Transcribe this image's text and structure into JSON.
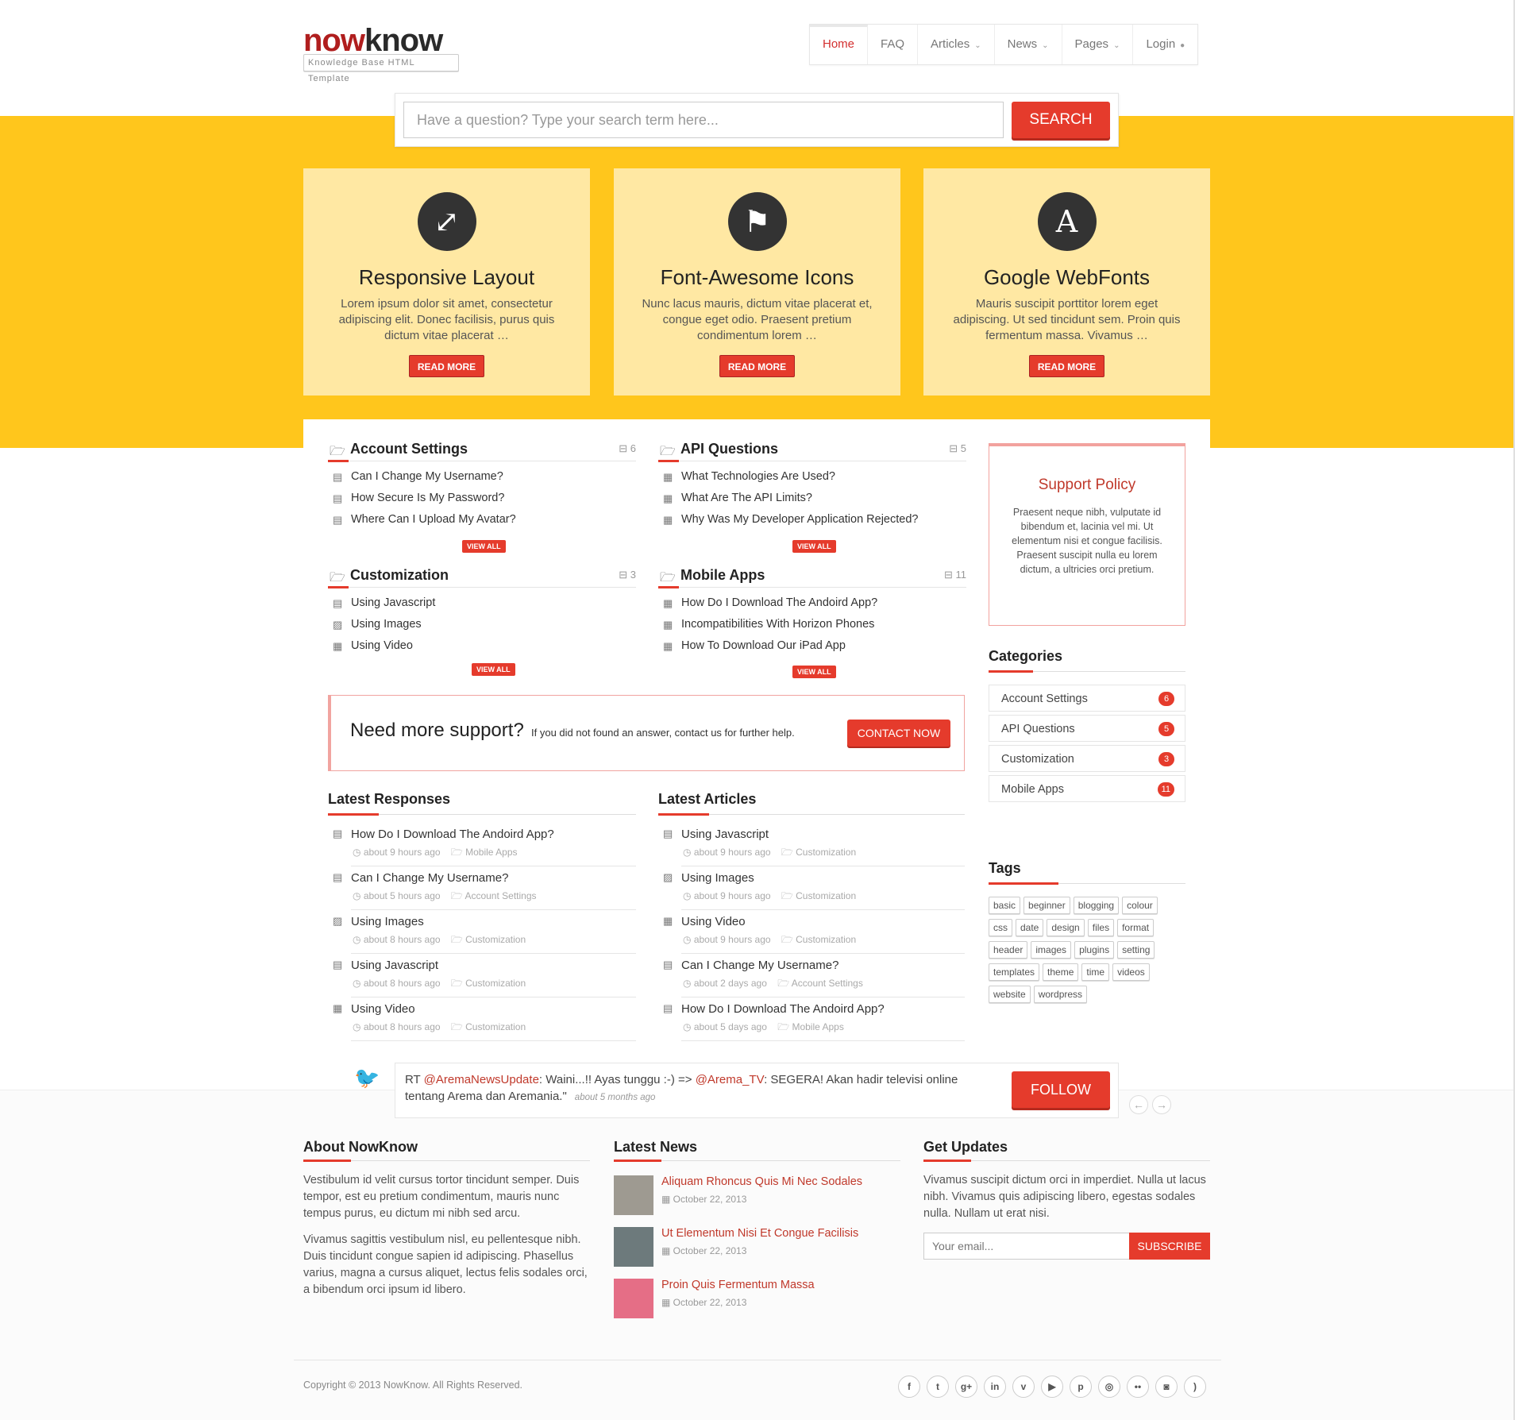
{
  "brand": {
    "logo_now": "now",
    "logo_know": "know",
    "logo_tagline": "Knowledge Base HTML Template"
  },
  "nav": [
    {
      "label": "Home",
      "active": true
    },
    {
      "label": "FAQ"
    },
    {
      "label": "Articles",
      "caret": "⌄"
    },
    {
      "label": "News",
      "caret": "⌄"
    },
    {
      "label": "Pages",
      "caret": "⌄"
    },
    {
      "label": "Login",
      "caret": "●"
    }
  ],
  "search": {
    "placeholder": "Have a question? Type your search term here...",
    "button": "SEARCH"
  },
  "features": [
    {
      "icon": "expand-arrows-icon",
      "glyph": "⤢",
      "title": "Responsive Layout",
      "text": "Lorem ipsum dolor sit amet, consectetur adipiscing elit. Donec facilisis, purus quis dictum vitae placerat …",
      "button": "READ MORE"
    },
    {
      "icon": "flag-icon",
      "glyph": "⚑",
      "title": "Font-Awesome Icons",
      "text": "Nunc lacus mauris, dictum vitae placerat et, congue eget odio. Praesent pretium condimentum lorem …",
      "button": "READ MORE"
    },
    {
      "icon": "font-a-icon",
      "glyph": "A",
      "title": "Google WebFonts",
      "text": "Mauris suscipit porttitor lorem eget adipiscing. Ut sed tincidunt sem. Proin quis fermentum massa. Vivamus …",
      "button": "READ MORE"
    }
  ],
  "categories_blocks": [
    {
      "title": "Account Settings",
      "count": "6",
      "items": [
        "Can I Change My Username?",
        "How Secure Is My Password?",
        "Where Can I Upload My Avatar?"
      ],
      "view_all": "VIEW ALL"
    },
    {
      "title": "API Questions",
      "count": "5",
      "items": [
        "What Technologies Are Used?",
        "What Are The API Limits?",
        "Why Was My Developer Application Rejected?"
      ],
      "view_all": "VIEW ALL"
    },
    {
      "title": "Customization",
      "count": "3",
      "items": [
        "Using Javascript",
        "Using Images",
        "Using Video"
      ],
      "view_all": "VIEW ALL"
    },
    {
      "title": "Mobile Apps",
      "count": "11",
      "items": [
        "How Do I Download The Andoird App?",
        "Incompatibilities With Horizon Phones",
        "How To Download Our iPad App"
      ],
      "view_all": "VIEW ALL"
    }
  ],
  "support": {
    "big": "Need more support?",
    "small": "If you did not found an answer, contact us for further help.",
    "button": "CONTACT NOW"
  },
  "latest_responses": {
    "title": "Latest Responses",
    "items": [
      {
        "title": "How Do I Download The Andoird App?",
        "time": "about 9 hours ago",
        "cat": "Mobile Apps"
      },
      {
        "title": "Can I Change My Username?",
        "time": "about 5 hours ago",
        "cat": "Account Settings"
      },
      {
        "title": "Using Images",
        "time": "about 8 hours ago",
        "cat": "Customization"
      },
      {
        "title": "Using Javascript",
        "time": "about 8 hours ago",
        "cat": "Customization"
      },
      {
        "title": "Using Video",
        "time": "about 8 hours ago",
        "cat": "Customization"
      }
    ]
  },
  "latest_articles": {
    "title": "Latest Articles",
    "items": [
      {
        "title": "Using Javascript",
        "time": "about 9 hours ago",
        "cat": "Customization"
      },
      {
        "title": "Using Images",
        "time": "about 9 hours ago",
        "cat": "Customization"
      },
      {
        "title": "Using Video",
        "time": "about 9 hours ago",
        "cat": "Customization"
      },
      {
        "title": "Can I Change My Username?",
        "time": "about 2 days ago",
        "cat": "Account Settings"
      },
      {
        "title": "How Do I Download The Andoird App?",
        "time": "about 5 days ago",
        "cat": "Mobile Apps"
      }
    ]
  },
  "sidebar": {
    "policy_title": "Support Policy",
    "policy_text": "Praesent neque nibh, vulputate id bibendum et, lacinia vel mi. Ut elementum nisi et congue facilisis. Praesent suscipit nulla eu lorem dictum, a ultricies orci pretium.",
    "categories_title": "Categories",
    "categories": [
      {
        "name": "Account Settings",
        "count": "6"
      },
      {
        "name": "API Questions",
        "count": "5"
      },
      {
        "name": "Customization",
        "count": "3"
      },
      {
        "name": "Mobile Apps",
        "count": "11"
      }
    ],
    "tags_title": "Tags",
    "tags": [
      "basic",
      "beginner",
      "blogging",
      "colour",
      "css",
      "date",
      "design",
      "files",
      "format",
      "header",
      "images",
      "plugins",
      "setting",
      "templates",
      "theme",
      "time",
      "videos",
      "website",
      "wordpress"
    ]
  },
  "tweet": {
    "rt": "RT ",
    "handle1": "@AremaNewsUpdate",
    "text1": ": Waini...!! Ayas tunggu :-) => ",
    "handle2": "@Arema_TV",
    "text2": ": SEGERA! Akan hadir televisi online tentang Arema dan Aremania.\"",
    "ago": "about 5 months ago",
    "button": "FOLLOW"
  },
  "footer": {
    "about_title": "About NowKnow",
    "about_p1": "Vestibulum id velit cursus tortor tincidunt semper. Duis tempor, est eu pretium condimentum, mauris nunc tempus purus, eu dictum mi nibh sed arcu.",
    "about_p2": "Vivamus sagittis vestibulum nisl, eu pellentesque nibh. Duis tincidunt congue sapien id adipiscing. Phasellus varius, magna a cursus aliquet, lectus felis sodales orci, a bibendum orci ipsum id libero.",
    "news_title": "Latest News",
    "news": [
      {
        "title": "Aliquam Rhoncus Quis Mi Nec Sodales",
        "date": "October 22, 2013"
      },
      {
        "title": "Ut Elementum Nisi Et Congue Facilisis",
        "date": "October 22, 2013"
      },
      {
        "title": "Proin Quis Fermentum Massa",
        "date": "October 22, 2013"
      }
    ],
    "updates_title": "Get Updates",
    "updates_text": "Vivamus suscipit dictum orci in imperdiet. Nulla ut lacus nibh. Vivamus quis adipiscing libero, egestas sodales nulla. Nullam ut erat nisi.",
    "email_placeholder": "Your email...",
    "subscribe": "SUBSCRIBE",
    "copyright": "Copyright © 2013 NowKnow. All Rights Reserved.",
    "social": [
      {
        "icon": "facebook-icon",
        "glyph": "f"
      },
      {
        "icon": "twitter-icon",
        "glyph": "t"
      },
      {
        "icon": "google-plus-icon",
        "glyph": "g+"
      },
      {
        "icon": "linkedin-icon",
        "glyph": "in"
      },
      {
        "icon": "vimeo-icon",
        "glyph": "v"
      },
      {
        "icon": "youtube-icon",
        "glyph": "▶"
      },
      {
        "icon": "pinterest-icon",
        "glyph": "p"
      },
      {
        "icon": "dribbble-icon",
        "glyph": "◎"
      },
      {
        "icon": "flickr-icon",
        "glyph": "••"
      },
      {
        "icon": "instagram-icon",
        "glyph": "◙"
      },
      {
        "icon": "rss-icon",
        "glyph": ")"
      }
    ]
  },
  "colors": {
    "accent": "#e53b2c",
    "band": "#ffc61c",
    "card": "#ffe8a3"
  }
}
